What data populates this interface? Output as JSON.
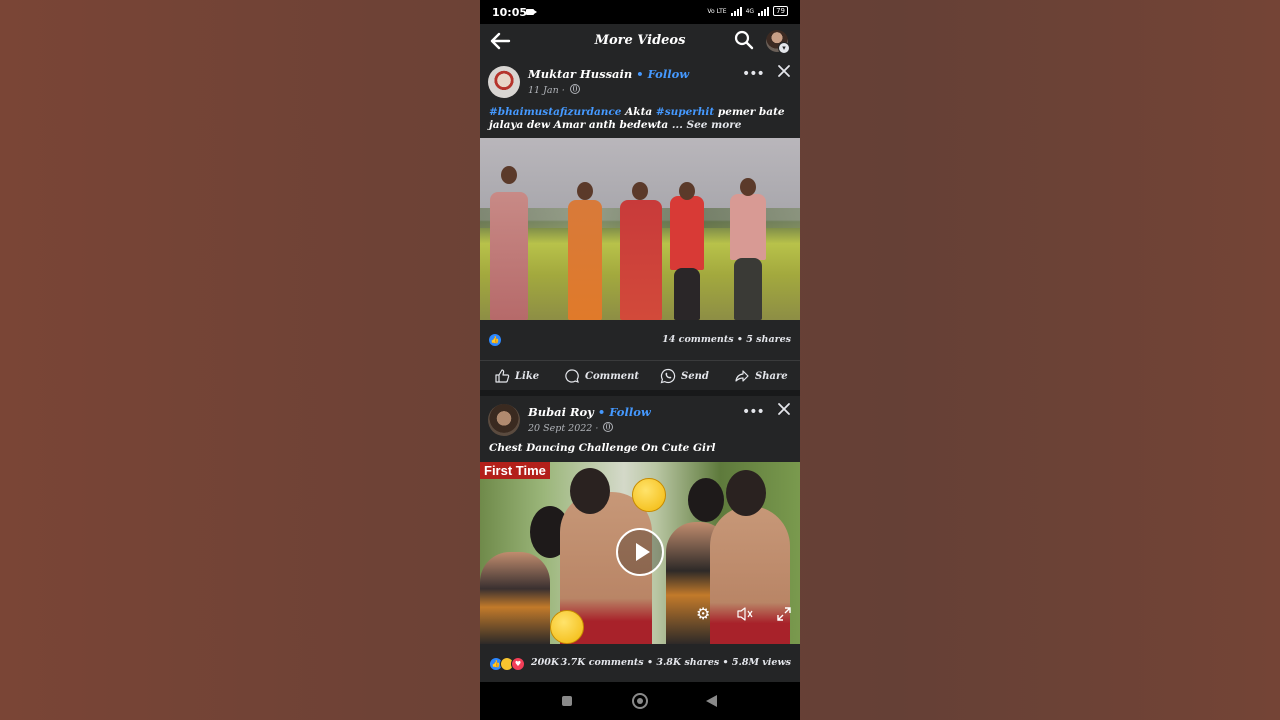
{
  "status_bar": {
    "time": "10:05",
    "battery": "79",
    "net1": "Vo LTE",
    "net2": "4G"
  },
  "header": {
    "title": "More Videos"
  },
  "posts": [
    {
      "author": "Muktar Hussain",
      "follow": "Follow",
      "separator": "•",
      "date": "11 Jan ·",
      "caption": {
        "tag1": "#bhaimustafizurdance",
        "text1": " Akta ",
        "tag2": "#superhit",
        "text2": " pemer bate jalaya dew   Amar anth bedewta  ",
        "see_more": "... See more"
      },
      "counts": "14 comments • 5 shares",
      "actions": {
        "like": "Like",
        "comment": "Comment",
        "send": "Send",
        "share": "Share"
      }
    },
    {
      "author": "Bubai Roy",
      "follow": "Follow",
      "separator": "•",
      "date": "20 Sept 2022 ·",
      "caption": "Chest Dancing Challenge On Cute Girl",
      "thumbnail_badge": "First Time",
      "reactions": "200K",
      "counts": "3.7K comments • 3.8K shares • 5.8M views"
    }
  ],
  "colors": {
    "accent": "#4599ff",
    "background": "#242526",
    "like": "#2d88ff"
  }
}
